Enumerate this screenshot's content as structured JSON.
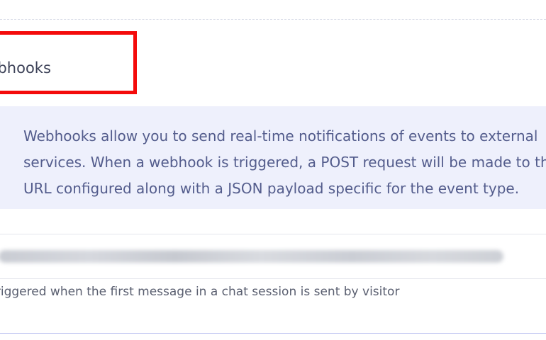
{
  "section": {
    "title": "Webhooks"
  },
  "info": {
    "lines": [
      "Webhooks allow you to send real-time notifications of events to external",
      "services. When a webhook is triggered, a POST request will be made to the",
      "URL configured along with a JSON payload specific for the event type."
    ]
  },
  "webhook": {
    "url_blurred": true,
    "event_description": "Triggered when the first message in a chat session is sent by visitor"
  },
  "colors": {
    "highlight": "#f40b0b",
    "info_background": "#eef0fc",
    "info_text": "#535c8c"
  }
}
